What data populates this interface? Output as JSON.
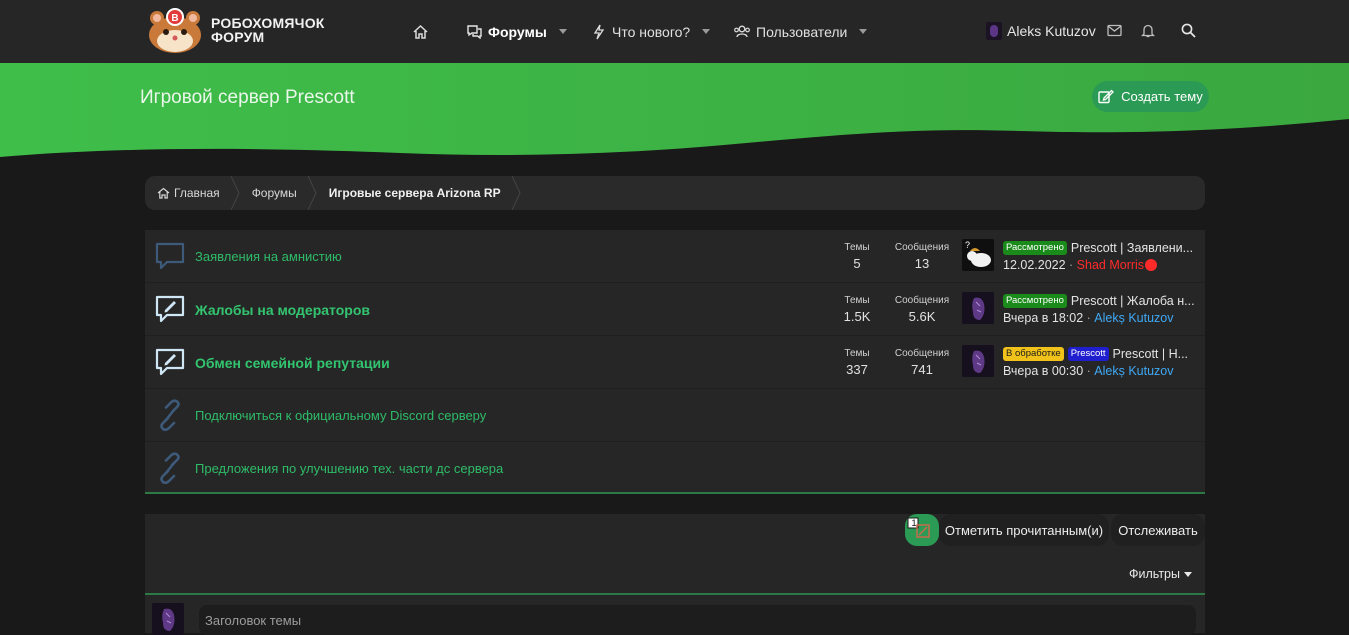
{
  "header": {
    "logo_line1": "РОБОХОМЯЧОК",
    "logo_line2": "ФОРУМ",
    "nav": {
      "home_icon": "home-icon",
      "forums": "Форумы",
      "whats_new": "Что нового?",
      "members": "Пользователи"
    },
    "user_name": "Aleks Kutuzov",
    "icons": [
      "envelope-icon",
      "bell-icon",
      "search-icon"
    ]
  },
  "hero": {
    "title": "Игровой сервер Prescott",
    "create_label": "Создать тему"
  },
  "breadcrumb": [
    "Главная",
    "Форумы",
    "Игровые сервера Arizona RP"
  ],
  "forums": [
    {
      "title": "Заявления на амнистию",
      "bold": false,
      "icon": "chat-bubble-icon",
      "threads_label": "Темы",
      "threads": "5",
      "posts_label": "Сообщения",
      "posts": "13",
      "last_badge": "Рассмотрено",
      "last_title": "Prescott | Заявлени...",
      "last_date": "12.02.2022",
      "last_user": "Shad Morris"
    },
    {
      "title": "Жалобы на модераторов",
      "bold": true,
      "icon": "chat-edit-icon",
      "threads_label": "Темы",
      "threads": "1.5K",
      "posts_label": "Сообщения",
      "posts": "5.6K",
      "last_badge": "Рассмотрено",
      "last_title": "Prescott | Жалоба н...",
      "last_date": "Вчера в 18:02",
      "last_user": "Alekș Kutuzov"
    },
    {
      "title": "Обмен семейной репутации",
      "bold": true,
      "icon": "chat-edit-icon",
      "threads_label": "Темы",
      "threads": "337",
      "posts_label": "Сообщения",
      "posts": "741",
      "last_badge": "В обработке",
      "last_badge2": "Prescott",
      "last_title": "Prescott | Н...",
      "last_date": "Вчера в 00:30",
      "last_user": "Alekș Kutuzov"
    },
    {
      "title": "Подключиться к официальному Discord серверу",
      "icon": "link-icon"
    },
    {
      "title": "Предложения по улучшению тех. части дс сервера",
      "icon": "link-icon"
    }
  ],
  "threads": {
    "count_badge": "1",
    "mark_read": "Отметить прочитанным(и)",
    "watch": "Отслеживать",
    "filters": "Фильтры",
    "title_placeholder": "Заголовок темы"
  },
  "colors": {
    "accent_green": "#2b9a55",
    "hero_green": "#3cb54a",
    "link_green": "#2ebc68",
    "user_blue": "#3fa9f5",
    "user_red": "#ff2a2a"
  }
}
